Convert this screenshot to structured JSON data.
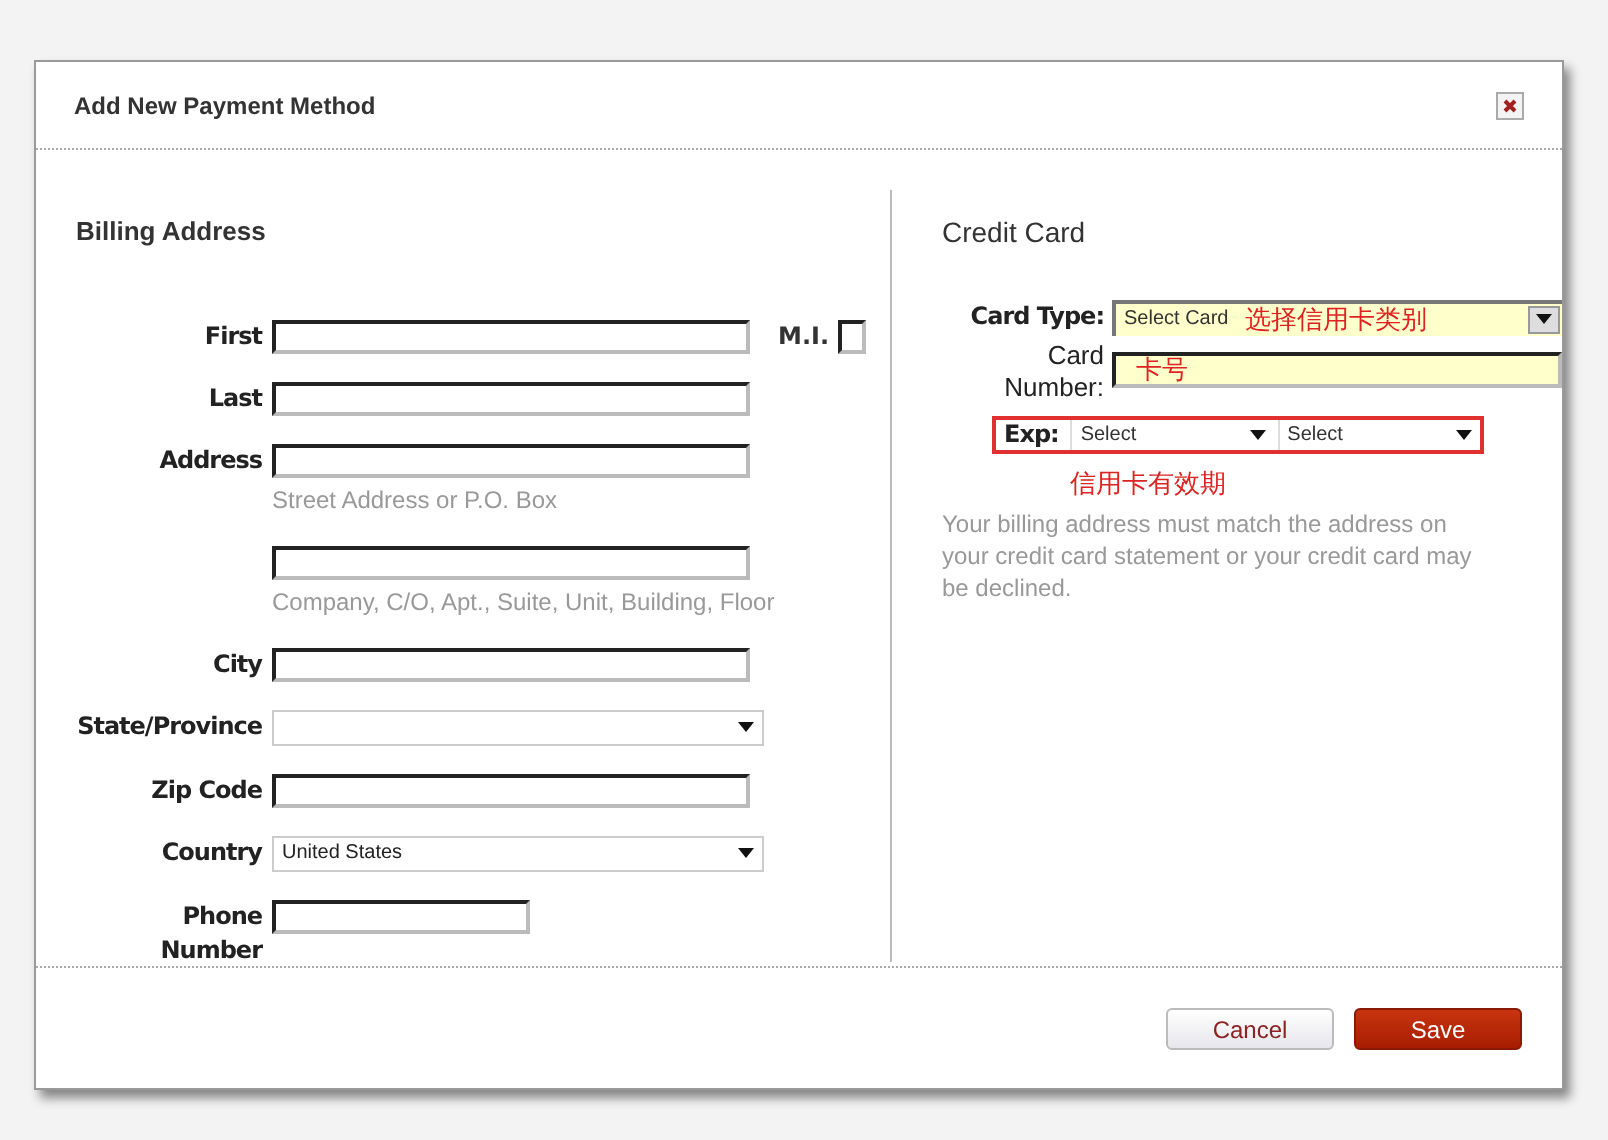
{
  "dialog": {
    "title": "Add New Payment Method"
  },
  "billing": {
    "heading": "Billing Address",
    "fields": [
      {
        "kind": "text",
        "label": "First",
        "extra": {
          "label": "M.I."
        }
      },
      {
        "kind": "text",
        "label": "Last"
      },
      {
        "kind": "text",
        "label": "Address",
        "hint": "Street Address or P.O. Box"
      },
      {
        "kind": "text",
        "hint": "Company, C/O, Apt., Suite, Unit, Building, Floor"
      },
      {
        "kind": "text",
        "label": "City"
      },
      {
        "kind": "select",
        "label": "State/Province"
      },
      {
        "kind": "text",
        "label": "Zip Code"
      },
      {
        "kind": "select",
        "label": "Country",
        "value": "United States"
      },
      {
        "kind": "short",
        "label": "Phone Number"
      }
    ]
  },
  "credit_card": {
    "heading": "Credit Card",
    "card_type": {
      "label": "Card Type:",
      "value": "Select Card",
      "annotation": "选择信用卡类别"
    },
    "card_number": {
      "label": "Card Number:",
      "annotation": "卡号"
    },
    "expiry": {
      "label": "Exp:",
      "selects": [
        "Select",
        "Select"
      ],
      "annotation": "信用卡有效期"
    },
    "note": "Your billing address must match the address on your credit card statement or your credit card may be declined."
  },
  "buttons": [
    {
      "kind": "secondary",
      "label": "Cancel"
    },
    {
      "kind": "primary",
      "label": "Save"
    }
  ]
}
